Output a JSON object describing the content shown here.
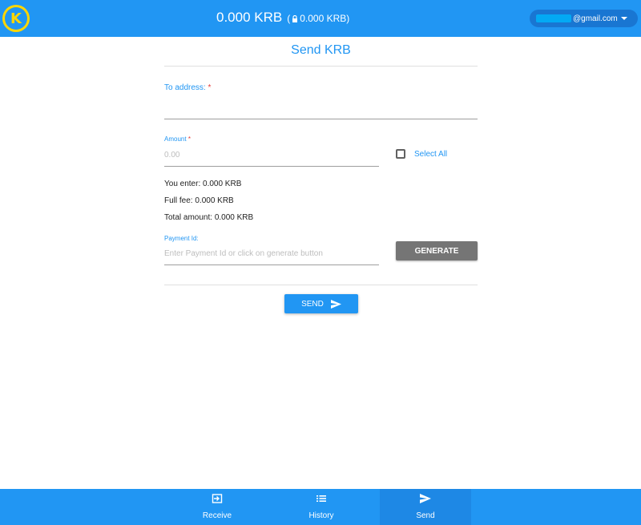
{
  "header": {
    "logo_letter": "K",
    "balance": "0.000 KRB",
    "locked_balance": "0.000 KRB",
    "account_email": "@gmail.com"
  },
  "form": {
    "title": "Send KRB",
    "to_address": {
      "label": "To address:",
      "required": "*",
      "value": ""
    },
    "amount": {
      "label": "Amount",
      "required": "*",
      "placeholder": "0.00",
      "value": ""
    },
    "select_all_label": "Select All",
    "you_enter": "You enter: 0.000 KRB",
    "full_fee": "Full fee: 0.000 KRB",
    "total_amount": "Total amount: 0.000 KRB",
    "payment_id": {
      "label": "Payment Id:",
      "placeholder": "Enter Payment Id or click on generate button",
      "value": ""
    },
    "generate_label": "GENERATE",
    "send_label": "SEND"
  },
  "bottom_nav": {
    "items": [
      {
        "label": "Receive",
        "icon": "receive-icon",
        "active": false
      },
      {
        "label": "History",
        "icon": "list-icon",
        "active": false
      },
      {
        "label": "Send",
        "icon": "send-icon",
        "active": true
      }
    ]
  },
  "colors": {
    "primary": "#2196f3",
    "logo_accent": "#ffd600",
    "required": "#e53935",
    "generate_button": "#757575"
  }
}
